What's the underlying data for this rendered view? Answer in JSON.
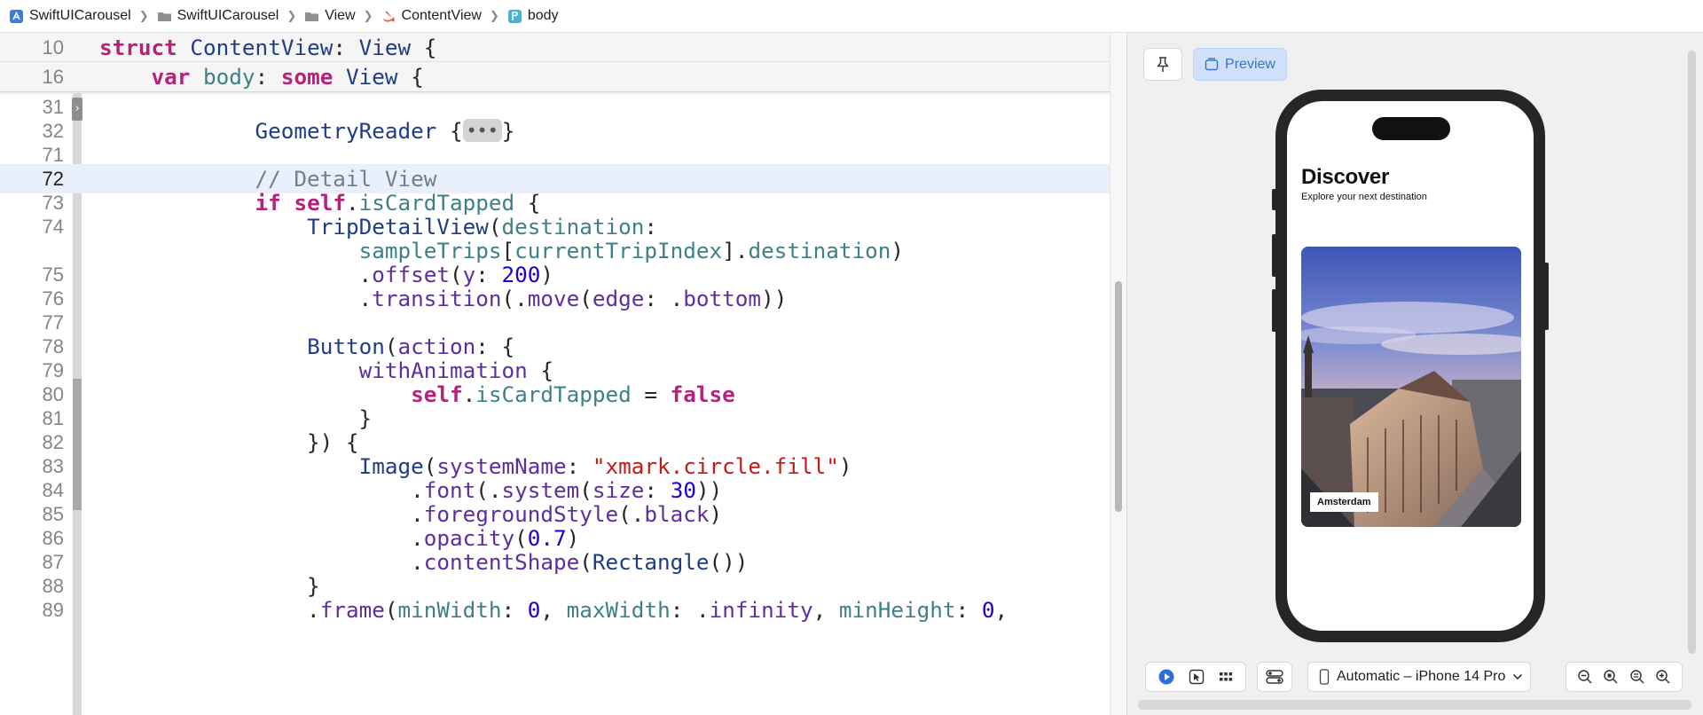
{
  "breadcrumb": [
    {
      "label": "SwiftUICarousel",
      "icon": "app-project-icon"
    },
    {
      "label": "SwiftUICarousel",
      "icon": "folder-icon"
    },
    {
      "label": "View",
      "icon": "folder-icon"
    },
    {
      "label": "ContentView",
      "icon": "swift-file-icon"
    },
    {
      "label": "body",
      "icon": "property-icon"
    }
  ],
  "editor": {
    "sticky_lines": [
      {
        "num": "10",
        "code": "struct ContentView: View {"
      },
      {
        "num": "16",
        "code": "    var body: some View {"
      }
    ],
    "lines": [
      {
        "num": "31",
        "code": ""
      },
      {
        "num": "32",
        "code": "            GeometryReader {•••}"
      },
      {
        "num": "71",
        "code": ""
      },
      {
        "num": "72",
        "code": "            // Detail View"
      },
      {
        "num": "73",
        "code": "            if self.isCardTapped {"
      },
      {
        "num": "74",
        "code": "                TripDetailView(destination:"
      },
      {
        "num": "",
        "code": "                    sampleTrips[currentTripIndex].destination)"
      },
      {
        "num": "75",
        "code": "                    .offset(y: 200)"
      },
      {
        "num": "76",
        "code": "                    .transition(.move(edge: .bottom))"
      },
      {
        "num": "77",
        "code": ""
      },
      {
        "num": "78",
        "code": "                Button(action: {"
      },
      {
        "num": "79",
        "code": "                    withAnimation {"
      },
      {
        "num": "80",
        "code": "                        self.isCardTapped = false"
      },
      {
        "num": "81",
        "code": "                    }"
      },
      {
        "num": "82",
        "code": "                }) {"
      },
      {
        "num": "83",
        "code": "                    Image(systemName: \"xmark.circle.fill\")"
      },
      {
        "num": "84",
        "code": "                        .font(.system(size: 30))"
      },
      {
        "num": "85",
        "code": "                        .foregroundStyle(.black)"
      },
      {
        "num": "86",
        "code": "                        .opacity(0.7)"
      },
      {
        "num": "87",
        "code": "                        .contentShape(Rectangle())"
      },
      {
        "num": "88",
        "code": "                }"
      },
      {
        "num": "89",
        "code": "                .frame(minWidth: 0, maxWidth: .infinity, minHeight: 0,"
      }
    ],
    "current_line": "72"
  },
  "canvas": {
    "pin_icon": "pin-icon",
    "preview_label": "Preview",
    "phone": {
      "title": "Discover",
      "subtitle": "Explore your next destination",
      "card_label": "Amsterdam"
    },
    "device_label": "Automatic – iPhone 14 Pro"
  },
  "colors": {
    "keyword": "#b5227a",
    "type": "#1f3c86",
    "property": "#3e8087",
    "function": "#5d2e9f",
    "number": "#1c00cf",
    "string": "#c41a16",
    "comment": "#707f8c",
    "accent": "#3a74c8",
    "current_line_bg": "#eaf0fb"
  }
}
